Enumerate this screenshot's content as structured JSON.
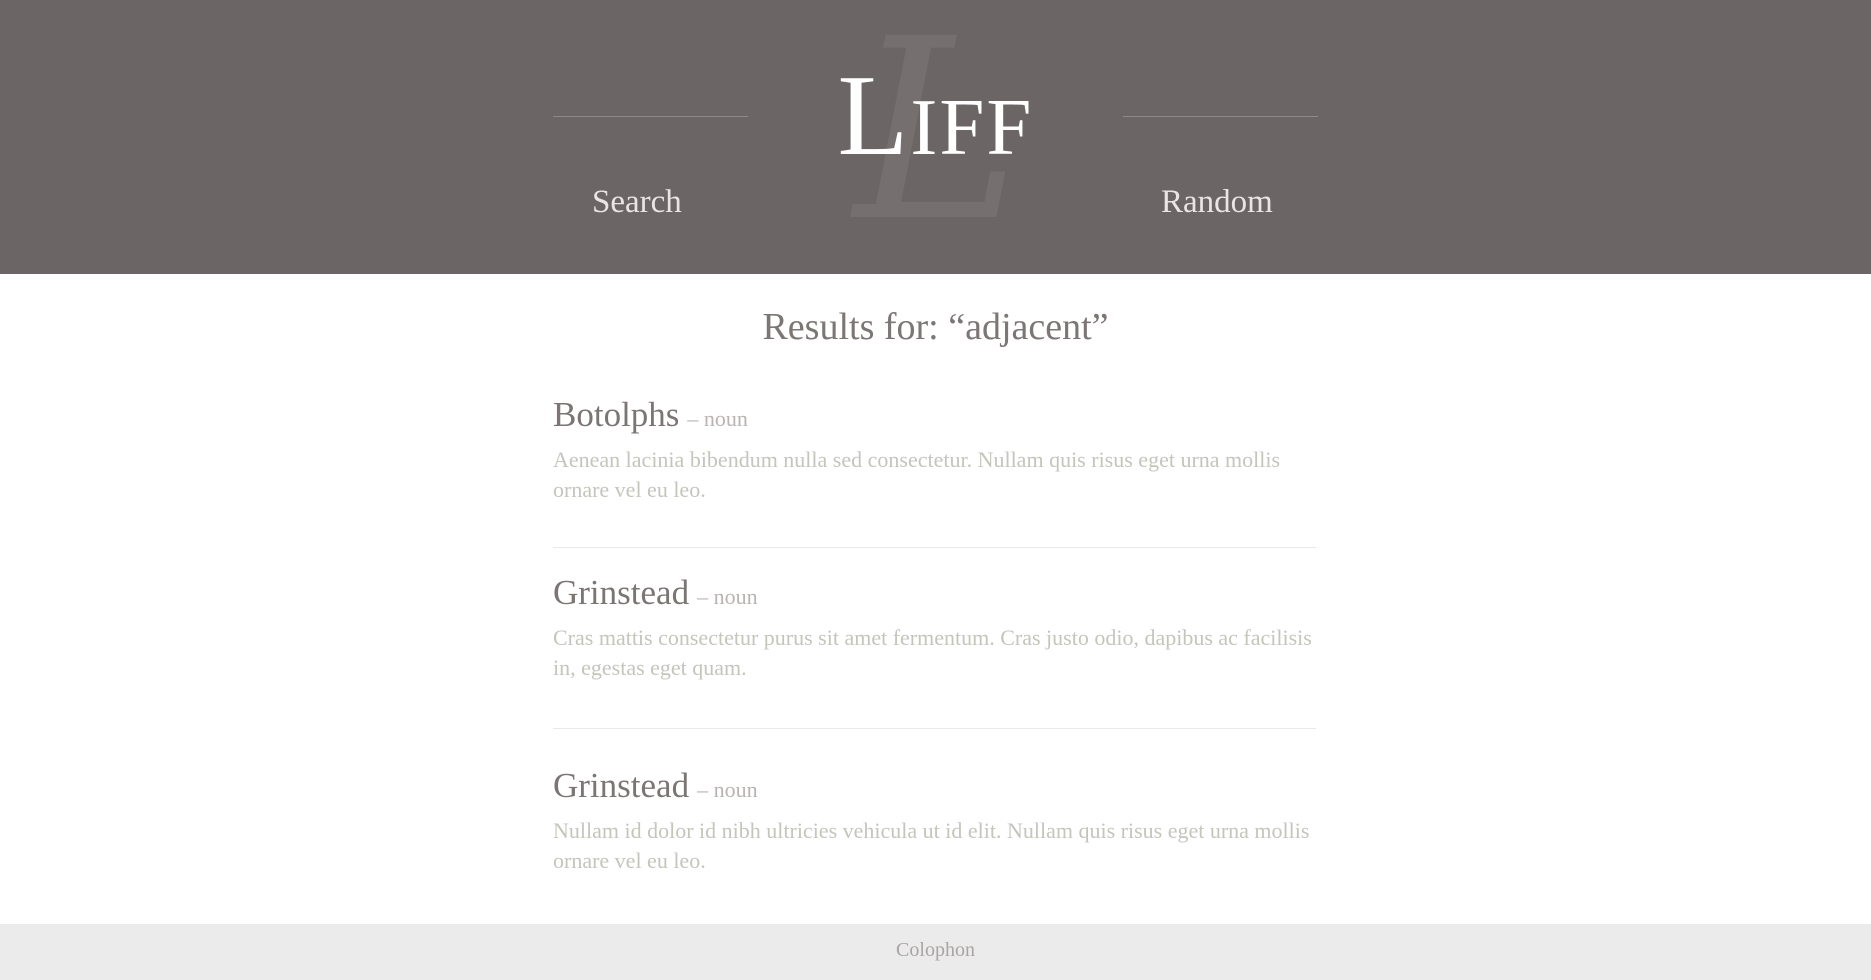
{
  "header": {
    "logo": "Liff",
    "watermark": "L",
    "nav": {
      "search_label": "Search",
      "random_label": "Random"
    },
    "colors": {
      "background": "#6c6565",
      "logo": "#ffffff"
    }
  },
  "results": {
    "title": "Results for: “adjacent”",
    "entries": [
      {
        "word": "Botolphs",
        "pos": "– noun",
        "definition": "Aenean lacinia bibendum nulla sed consectetur. Nullam quis risus eget urna mollis ornare vel eu leo."
      },
      {
        "word": "Grinstead",
        "pos": "– noun",
        "definition": "Cras mattis consectetur purus sit amet fermentum. Cras justo odio, dapibus ac facilisis in, egestas eget quam."
      },
      {
        "word": "Grinstead",
        "pos": "– noun",
        "definition": "Nullam id dolor id nibh ultricies vehicula ut id elit. Nullam quis risus eget urna mollis ornare vel eu leo."
      }
    ]
  },
  "footer": {
    "colophon_label": "Colophon"
  }
}
